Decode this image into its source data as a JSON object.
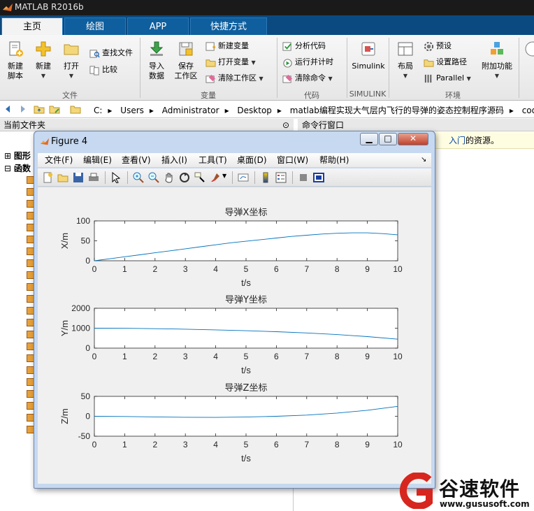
{
  "window": {
    "title": "MATLAB R2016b"
  },
  "tabs": [
    {
      "label": "主页",
      "active": true
    },
    {
      "label": "绘图",
      "active": false
    },
    {
      "label": "APP",
      "active": false
    },
    {
      "label": "快捷方式",
      "active": false
    }
  ],
  "ribbon": {
    "file": {
      "section_label": "文件",
      "new_script": "新建\n脚本",
      "new": "新建",
      "open": "打开",
      "find_files": "查找文件",
      "compare": "比较"
    },
    "variable": {
      "section_label": "变量",
      "import_data": "导入\n数据",
      "save_workspace": "保存\n工作区",
      "new_variable": "新建变量",
      "open_variable": "打开变量",
      "clear_workspace": "清除工作区"
    },
    "code": {
      "section_label": "代码",
      "analyze_code": "分析代码",
      "run_and_time": "运行并计时",
      "clear_commands": "清除命令"
    },
    "simulink": {
      "section_label": "SIMULINK",
      "simulink": "Simulink"
    },
    "environment": {
      "section_label": "环境",
      "layout": "布局",
      "preferences": "预设",
      "set_path": "设置路径",
      "parallel": "Parallel",
      "add_ons": "附加功能"
    }
  },
  "address": {
    "crumbs": [
      "C:",
      "Users",
      "Administrator",
      "Desktop",
      "matlab编程实现大气层内飞行的导弹的姿态控制程序源码",
      "code"
    ]
  },
  "current_folder": {
    "title": "当前文件夹",
    "tree": [
      {
        "label": "图形",
        "expand": "⊞"
      },
      {
        "label": "函数",
        "expand": "⊟"
      }
    ]
  },
  "command_window": {
    "title": "命令行窗口",
    "banner_link": "入门",
    "banner_text": "的资源。"
  },
  "figure": {
    "title": "Figure 4",
    "menus": [
      "文件(F)",
      "编辑(E)",
      "查看(V)",
      "插入(I)",
      "工具(T)",
      "桌面(D)",
      "窗口(W)",
      "帮助(H)"
    ]
  },
  "chart_data": [
    {
      "type": "line",
      "title": "导弹X坐标",
      "xlabel": "t/s",
      "ylabel": "X/m",
      "xlim": [
        0,
        10
      ],
      "ylim": [
        0,
        100
      ],
      "xticks": [
        0,
        1,
        2,
        3,
        4,
        5,
        6,
        7,
        8,
        9,
        10
      ],
      "yticks": [
        0,
        50,
        100
      ],
      "color": "#0072bd",
      "series": [
        {
          "x": [
            0,
            0.5,
            1,
            1.5,
            2,
            2.5,
            3,
            3.5,
            4,
            4.5,
            5,
            5.5,
            6,
            6.5,
            7,
            7.5,
            8,
            8.5,
            9,
            9.5,
            10
          ],
          "y": [
            0,
            5,
            10,
            15,
            20,
            25,
            30,
            35,
            40,
            45,
            49,
            53,
            57,
            61,
            64,
            67,
            69,
            70,
            70,
            68,
            65
          ]
        }
      ]
    },
    {
      "type": "line",
      "title": "导弹Y坐标",
      "xlabel": "t/s",
      "ylabel": "Y/m",
      "xlim": [
        0,
        10
      ],
      "ylim": [
        0,
        2000
      ],
      "xticks": [
        0,
        1,
        2,
        3,
        4,
        5,
        6,
        7,
        8,
        9,
        10
      ],
      "yticks": [
        0,
        1000,
        2000
      ],
      "color": "#0072bd",
      "series": [
        {
          "x": [
            0,
            1,
            2,
            3,
            4,
            5,
            6,
            7,
            8,
            9,
            10
          ],
          "y": [
            1000,
            995,
            975,
            950,
            915,
            875,
            825,
            760,
            680,
            580,
            450
          ]
        }
      ]
    },
    {
      "type": "line",
      "title": "导弹Z坐标",
      "xlabel": "t/s",
      "ylabel": "Z/m",
      "xlim": [
        0,
        10
      ],
      "ylim": [
        -50,
        50
      ],
      "xticks": [
        0,
        1,
        2,
        3,
        4,
        5,
        6,
        7,
        8,
        9,
        10
      ],
      "yticks": [
        -50,
        0,
        50
      ],
      "color": "#0072bd",
      "series": [
        {
          "x": [
            0,
            1,
            2,
            3,
            4,
            5,
            6,
            7,
            8,
            9,
            10
          ],
          "y": [
            0,
            -0.5,
            -1.5,
            -2.5,
            -2.8,
            -2,
            0,
            3,
            8,
            15,
            25
          ]
        }
      ]
    }
  ],
  "watermark": {
    "text": "谷速软件",
    "url": "www.gususoft.com"
  },
  "colors": {
    "tab_bar": "#0b4a80",
    "matlab_line": "#0072bd",
    "watermark_red": "#d7261e"
  }
}
